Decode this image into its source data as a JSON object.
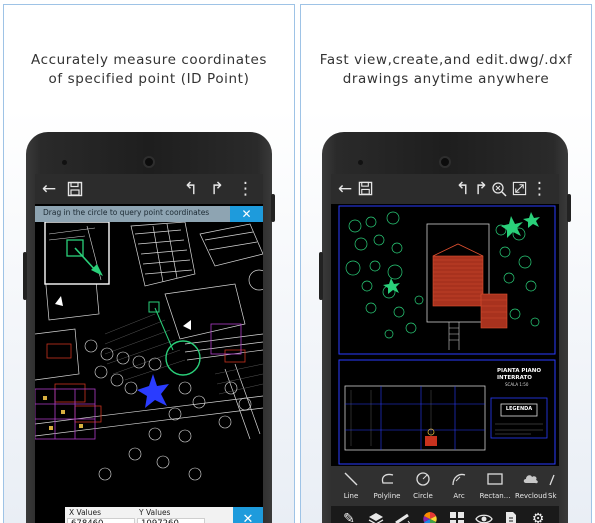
{
  "left_panel": {
    "caption_line1": "Accurately measure coordinates",
    "caption_line2": "of specified point (ID Point)",
    "toolbar": {
      "back_icon": "arrow-left-icon",
      "save_icon": "save-icon",
      "undo_icon": "undo-icon",
      "redo_icon": "redo-icon",
      "menu_icon": "more-vert-icon"
    },
    "hint": {
      "text": "Drag in the circle to query point coordinates",
      "close_symbol": "✕"
    },
    "coordinates": {
      "x_label": "X Values",
      "x_value": "678460",
      "y_label": "Y Values",
      "y_value": "1097260",
      "close_symbol": "✕"
    }
  },
  "right_panel": {
    "caption_line1": "Fast view,create,and edit.dwg/.dxf",
    "caption_line2": "drawings anytime anywhere",
    "drawing_title": "PIANTA PIANO INTERRATO",
    "drawing_subtitle": "SCALA 1:50",
    "legend_label": "LEGENDA",
    "tools": [
      {
        "label": "Line",
        "icon": "line-icon"
      },
      {
        "label": "Polyline",
        "icon": "polyline-icon"
      },
      {
        "label": "Circle",
        "icon": "circle-icon"
      },
      {
        "label": "Arc",
        "icon": "arc-icon"
      },
      {
        "label": "Rectan...",
        "icon": "rectangle-icon"
      },
      {
        "label": "Revcloud",
        "icon": "revcloud-icon"
      },
      {
        "label": "Sk",
        "icon": "sketch-icon"
      }
    ],
    "bottom_icons": [
      "pen-icon",
      "layers-icon",
      "measure-icon",
      "color-wheel-icon",
      "blocks-icon",
      "view-icon",
      "file-icon",
      "settings-icon"
    ]
  },
  "colors": {
    "panel_border": "#9ec3e6",
    "accent_blue": "#1e9bdc",
    "cad_green": "#2ad07a",
    "cad_blue": "#2a3cff",
    "cad_red": "#c8321e"
  }
}
